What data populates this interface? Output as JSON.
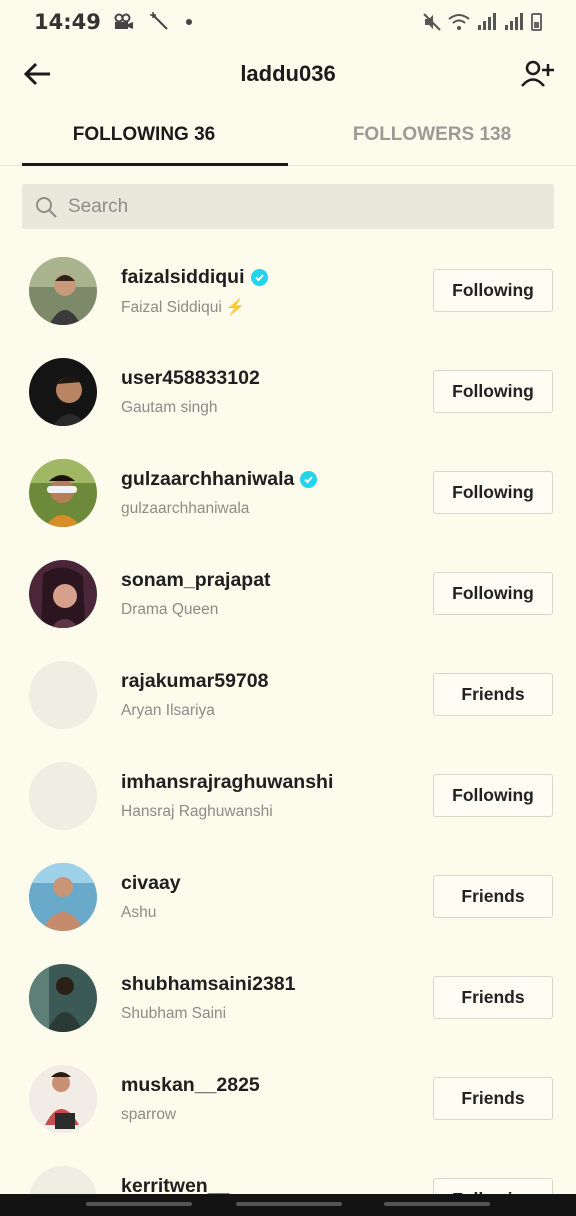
{
  "status_bar": {
    "time": "14:49"
  },
  "header": {
    "title": "laddu036",
    "back_icon": "arrow-left-icon",
    "add_icon": "add-user-icon"
  },
  "tabs": [
    {
      "label": "FOLLOWING 36",
      "active": true
    },
    {
      "label": "FOLLOWERS 138",
      "active": false
    }
  ],
  "search": {
    "placeholder": "Search",
    "value": ""
  },
  "colors": {
    "background": "#fcfbec",
    "verified": "#20d5ec",
    "tab_inactive": "#9a9a96"
  },
  "users": [
    {
      "username": "faizalsiddiqui",
      "display": "Faizal Siddiqui",
      "verified": true,
      "button": "Following",
      "emoji": "⚡"
    },
    {
      "username": "user458833102",
      "display": "Gautam singh",
      "verified": false,
      "button": "Following"
    },
    {
      "username": "gulzaarchhaniwala",
      "display": "gulzaarchhaniwala",
      "verified": true,
      "button": "Following"
    },
    {
      "username": "sonam_prajapat",
      "display": "Drama Queen",
      "verified": false,
      "button": "Following"
    },
    {
      "username": "rajakumar59708",
      "display": "Aryan Ilsariya",
      "verified": false,
      "button": "Friends"
    },
    {
      "username": "imhansrajraghuwanshi",
      "display": "Hansraj Raghuwanshi",
      "verified": false,
      "button": "Following"
    },
    {
      "username": "civaay",
      "display": "Ashu",
      "verified": false,
      "button": "Friends"
    },
    {
      "username": "shubhamsaini2381",
      "display": "Shubham Saini",
      "verified": false,
      "button": "Friends"
    },
    {
      "username": "muskan__2825",
      "display": "sparrow",
      "verified": false,
      "button": "Friends"
    },
    {
      "username": "kerritwen__",
      "display": "",
      "verified": false,
      "button": "Following"
    }
  ]
}
